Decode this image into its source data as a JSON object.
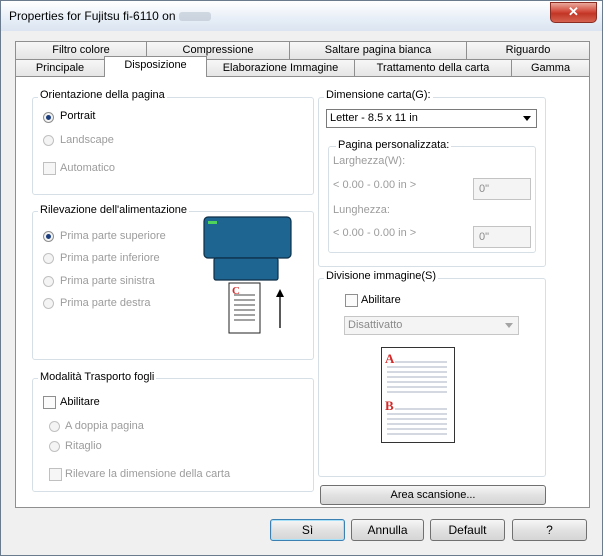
{
  "window": {
    "title": "Properties for Fujitsu fi-6110 on",
    "close_label": "✕"
  },
  "tabs_row1": [
    "Filtro colore",
    "Compressione",
    "Saltare pagina bianca",
    "Riguardo"
  ],
  "tabs_row2": [
    "Principale",
    "Disposizione",
    "Elaborazione Immagine",
    "Trattamento della carta",
    "Gamma"
  ],
  "orientation": {
    "title": "Orientazione della pagina",
    "portrait": "Portrait",
    "landscape": "Landscape",
    "automatic": "Automatico",
    "selected": "Portrait"
  },
  "feed_detection": {
    "title": "Rilevazione dell'alimentazione",
    "options": [
      "Prima parte superiore",
      "Prima parte inferiore",
      "Prima parte sinistra",
      "Prima parte destra"
    ],
    "selected": "Prima parte superiore",
    "illustration_letter": "C"
  },
  "carrier": {
    "title": "Modalità Trasporto fogli",
    "enable": "Abilitare",
    "double_page": "A doppia pagina",
    "crop": "Ritaglio",
    "detect_size": "Rilevare la dimensione della carta"
  },
  "paper_size": {
    "title": "Dimensione carta(G):",
    "value": "Letter - 8.5 x 11 in"
  },
  "custom_page": {
    "title": "Pagina personalizzata:",
    "width_label": "Larghezza(W):",
    "width_range": "< 0.00 - 0.00 in >",
    "width_value": "0\"",
    "length_label": "Lunghezza:",
    "length_range": "< 0.00 - 0.00 in >",
    "length_value": "0\""
  },
  "split": {
    "title": "Divisione immagine(S)",
    "enable": "Abilitare",
    "mode": "Disattivatto",
    "preview_labels": [
      "A",
      "B"
    ]
  },
  "area_button": "Area scansione...",
  "buttons": {
    "ok": "Sì",
    "cancel": "Annulla",
    "default": "Default",
    "help": "?"
  },
  "colors": {
    "scanner": "#1e6591",
    "accent_red": "#d42a2a",
    "selected_tab": "#ffffff"
  }
}
